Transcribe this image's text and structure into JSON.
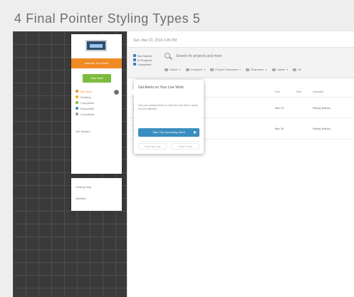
{
  "slide_title": "4 Final Pointer Styling Types 5",
  "app": {
    "date": "Sun, Mar 23, 2016 3:05 PM",
    "filters": [
      "Not Started",
      "In Progress",
      "Completed"
    ],
    "search_placeholder": "Search for projects and more",
    "toolbar": [
      "Owner",
      "Assignee",
      "Project Templates",
      "Requester",
      "Labels",
      "All"
    ],
    "columns": [
      "Due",
      "Due",
      "Updated"
    ],
    "rows": [
      {
        "due": "Mar 24",
        "updated": "Ready Marlon"
      },
      {
        "due": "Mar 26",
        "updated": "Ready Marlon"
      }
    ]
  },
  "sidebar": {
    "logo": "logo",
    "banner": "Improve Your Work",
    "new_task": "New Task",
    "statuses": [
      {
        "label": "My Work",
        "color": "#f08a24"
      },
      {
        "label": "Working",
        "color": "#f0b030"
      },
      {
        "label": "Completed",
        "color": "#7dbb3f"
      },
      {
        "label": "Requested",
        "color": "#3a8fc0"
      },
      {
        "label": "Completed",
        "color": "#999999"
      }
    ],
    "link": "Get Started",
    "sub_items": [
      "Getting Help",
      "Updates"
    ]
  },
  "popover": {
    "title": "Get Alerts on Your Live Work",
    "description": "Use your activity stream to view the work that is ready for your attention.",
    "primary": "Take Our Upcoming Work",
    "arrow": "▶",
    "secondary": [
      "Show Me How",
      "Close Panel"
    ]
  }
}
